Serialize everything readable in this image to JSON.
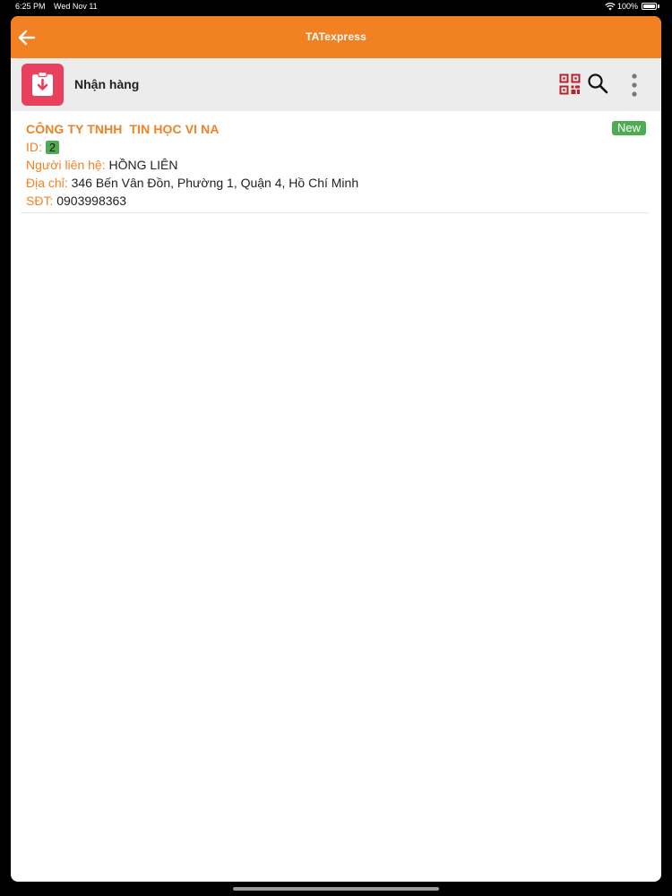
{
  "status_bar": {
    "time": "6:25 PM",
    "date": "Wed Nov 11",
    "battery": "100%"
  },
  "app_header": {
    "brand": "TATexpress",
    "back_icon": "arrow-left-icon",
    "color": "#f28123"
  },
  "sub_header": {
    "title": "Nhận hàng",
    "module_icon": "clipboard-download-icon",
    "module_color": "#e8405d",
    "actions": [
      "qr-code-icon",
      "search-icon",
      "more-vertical-icon"
    ]
  },
  "orders": [
    {
      "company": "CÔNG TY TNHH  TIN HỌC VI NA",
      "status": "New",
      "id_label": "ID:",
      "id": "2",
      "contact_label": "Người liên hệ:",
      "contact": "HỒNG LIÊN",
      "address_label": "Địa chỉ:",
      "address": "346 Bến Vân Đồn, Phường 1, Quận 4, Hồ Chí Minh",
      "phone_label": "SĐT:",
      "phone": "0903998363"
    }
  ],
  "colors": {
    "accent": "#f28123",
    "badge_green": "#4cad50"
  }
}
